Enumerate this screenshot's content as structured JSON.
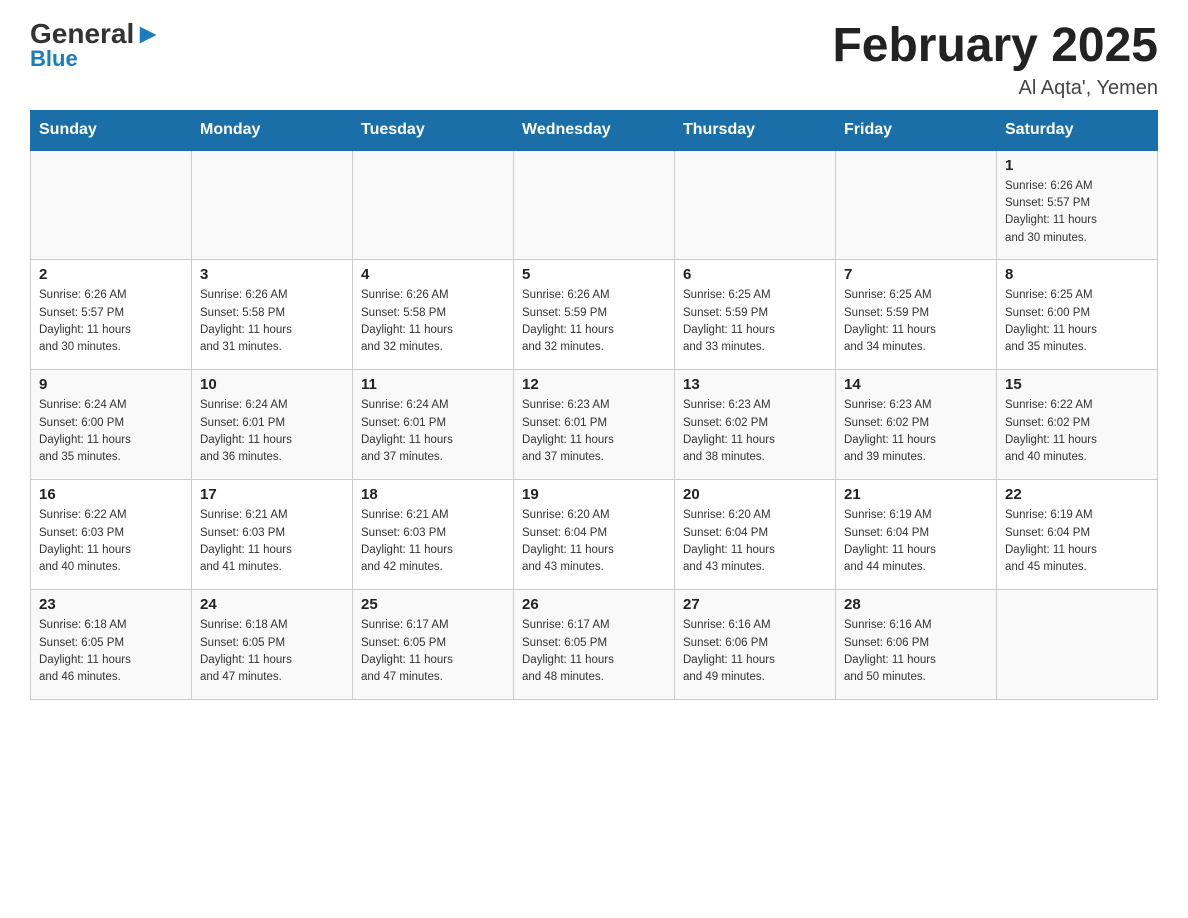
{
  "logo": {
    "general": "General",
    "blue": "Blue"
  },
  "title": "February 2025",
  "location": "Al Aqta', Yemen",
  "days_of_week": [
    "Sunday",
    "Monday",
    "Tuesday",
    "Wednesday",
    "Thursday",
    "Friday",
    "Saturday"
  ],
  "weeks": [
    [
      {
        "day": "",
        "info": ""
      },
      {
        "day": "",
        "info": ""
      },
      {
        "day": "",
        "info": ""
      },
      {
        "day": "",
        "info": ""
      },
      {
        "day": "",
        "info": ""
      },
      {
        "day": "",
        "info": ""
      },
      {
        "day": "1",
        "info": "Sunrise: 6:26 AM\nSunset: 5:57 PM\nDaylight: 11 hours\nand 30 minutes."
      }
    ],
    [
      {
        "day": "2",
        "info": "Sunrise: 6:26 AM\nSunset: 5:57 PM\nDaylight: 11 hours\nand 30 minutes."
      },
      {
        "day": "3",
        "info": "Sunrise: 6:26 AM\nSunset: 5:58 PM\nDaylight: 11 hours\nand 31 minutes."
      },
      {
        "day": "4",
        "info": "Sunrise: 6:26 AM\nSunset: 5:58 PM\nDaylight: 11 hours\nand 32 minutes."
      },
      {
        "day": "5",
        "info": "Sunrise: 6:26 AM\nSunset: 5:59 PM\nDaylight: 11 hours\nand 32 minutes."
      },
      {
        "day": "6",
        "info": "Sunrise: 6:25 AM\nSunset: 5:59 PM\nDaylight: 11 hours\nand 33 minutes."
      },
      {
        "day": "7",
        "info": "Sunrise: 6:25 AM\nSunset: 5:59 PM\nDaylight: 11 hours\nand 34 minutes."
      },
      {
        "day": "8",
        "info": "Sunrise: 6:25 AM\nSunset: 6:00 PM\nDaylight: 11 hours\nand 35 minutes."
      }
    ],
    [
      {
        "day": "9",
        "info": "Sunrise: 6:24 AM\nSunset: 6:00 PM\nDaylight: 11 hours\nand 35 minutes."
      },
      {
        "day": "10",
        "info": "Sunrise: 6:24 AM\nSunset: 6:01 PM\nDaylight: 11 hours\nand 36 minutes."
      },
      {
        "day": "11",
        "info": "Sunrise: 6:24 AM\nSunset: 6:01 PM\nDaylight: 11 hours\nand 37 minutes."
      },
      {
        "day": "12",
        "info": "Sunrise: 6:23 AM\nSunset: 6:01 PM\nDaylight: 11 hours\nand 37 minutes."
      },
      {
        "day": "13",
        "info": "Sunrise: 6:23 AM\nSunset: 6:02 PM\nDaylight: 11 hours\nand 38 minutes."
      },
      {
        "day": "14",
        "info": "Sunrise: 6:23 AM\nSunset: 6:02 PM\nDaylight: 11 hours\nand 39 minutes."
      },
      {
        "day": "15",
        "info": "Sunrise: 6:22 AM\nSunset: 6:02 PM\nDaylight: 11 hours\nand 40 minutes."
      }
    ],
    [
      {
        "day": "16",
        "info": "Sunrise: 6:22 AM\nSunset: 6:03 PM\nDaylight: 11 hours\nand 40 minutes."
      },
      {
        "day": "17",
        "info": "Sunrise: 6:21 AM\nSunset: 6:03 PM\nDaylight: 11 hours\nand 41 minutes."
      },
      {
        "day": "18",
        "info": "Sunrise: 6:21 AM\nSunset: 6:03 PM\nDaylight: 11 hours\nand 42 minutes."
      },
      {
        "day": "19",
        "info": "Sunrise: 6:20 AM\nSunset: 6:04 PM\nDaylight: 11 hours\nand 43 minutes."
      },
      {
        "day": "20",
        "info": "Sunrise: 6:20 AM\nSunset: 6:04 PM\nDaylight: 11 hours\nand 43 minutes."
      },
      {
        "day": "21",
        "info": "Sunrise: 6:19 AM\nSunset: 6:04 PM\nDaylight: 11 hours\nand 44 minutes."
      },
      {
        "day": "22",
        "info": "Sunrise: 6:19 AM\nSunset: 6:04 PM\nDaylight: 11 hours\nand 45 minutes."
      }
    ],
    [
      {
        "day": "23",
        "info": "Sunrise: 6:18 AM\nSunset: 6:05 PM\nDaylight: 11 hours\nand 46 minutes."
      },
      {
        "day": "24",
        "info": "Sunrise: 6:18 AM\nSunset: 6:05 PM\nDaylight: 11 hours\nand 47 minutes."
      },
      {
        "day": "25",
        "info": "Sunrise: 6:17 AM\nSunset: 6:05 PM\nDaylight: 11 hours\nand 47 minutes."
      },
      {
        "day": "26",
        "info": "Sunrise: 6:17 AM\nSunset: 6:05 PM\nDaylight: 11 hours\nand 48 minutes."
      },
      {
        "day": "27",
        "info": "Sunrise: 6:16 AM\nSunset: 6:06 PM\nDaylight: 11 hours\nand 49 minutes."
      },
      {
        "day": "28",
        "info": "Sunrise: 6:16 AM\nSunset: 6:06 PM\nDaylight: 11 hours\nand 50 minutes."
      },
      {
        "day": "",
        "info": ""
      }
    ]
  ]
}
